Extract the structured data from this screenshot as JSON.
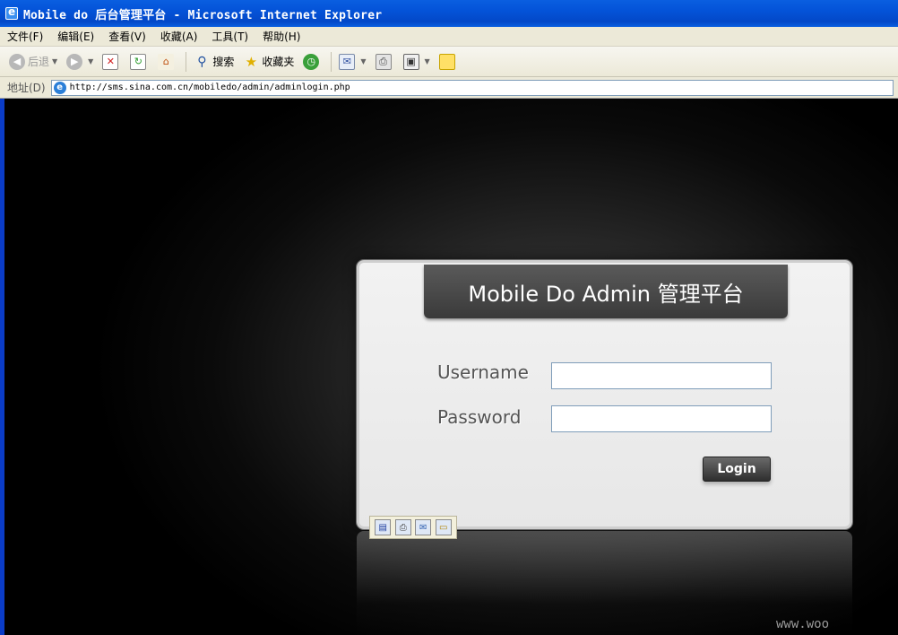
{
  "window": {
    "title": "Mobile do 后台管理平台 - Microsoft Internet Explorer"
  },
  "menu": {
    "items": [
      "文件(F)",
      "编辑(E)",
      "查看(V)",
      "收藏(A)",
      "工具(T)",
      "帮助(H)"
    ]
  },
  "toolbar": {
    "back_label": "后退",
    "search_label": "搜索",
    "favorites_label": "收藏夹"
  },
  "address": {
    "label": "地址(D)",
    "url": "http://sms.sina.com.cn/mobiledo/admin/adminlogin.php"
  },
  "login": {
    "header": "Mobile Do Admin 管理平台",
    "username_label": "Username",
    "password_label": "Password",
    "username_value": "",
    "password_value": "",
    "button_label": "Login"
  },
  "watermark": "www.woo",
  "colors": {
    "titlebar": "#0453d8",
    "chrome": "#ece9d8",
    "header_bg": "#454545",
    "panel_bg": "#ececec"
  }
}
